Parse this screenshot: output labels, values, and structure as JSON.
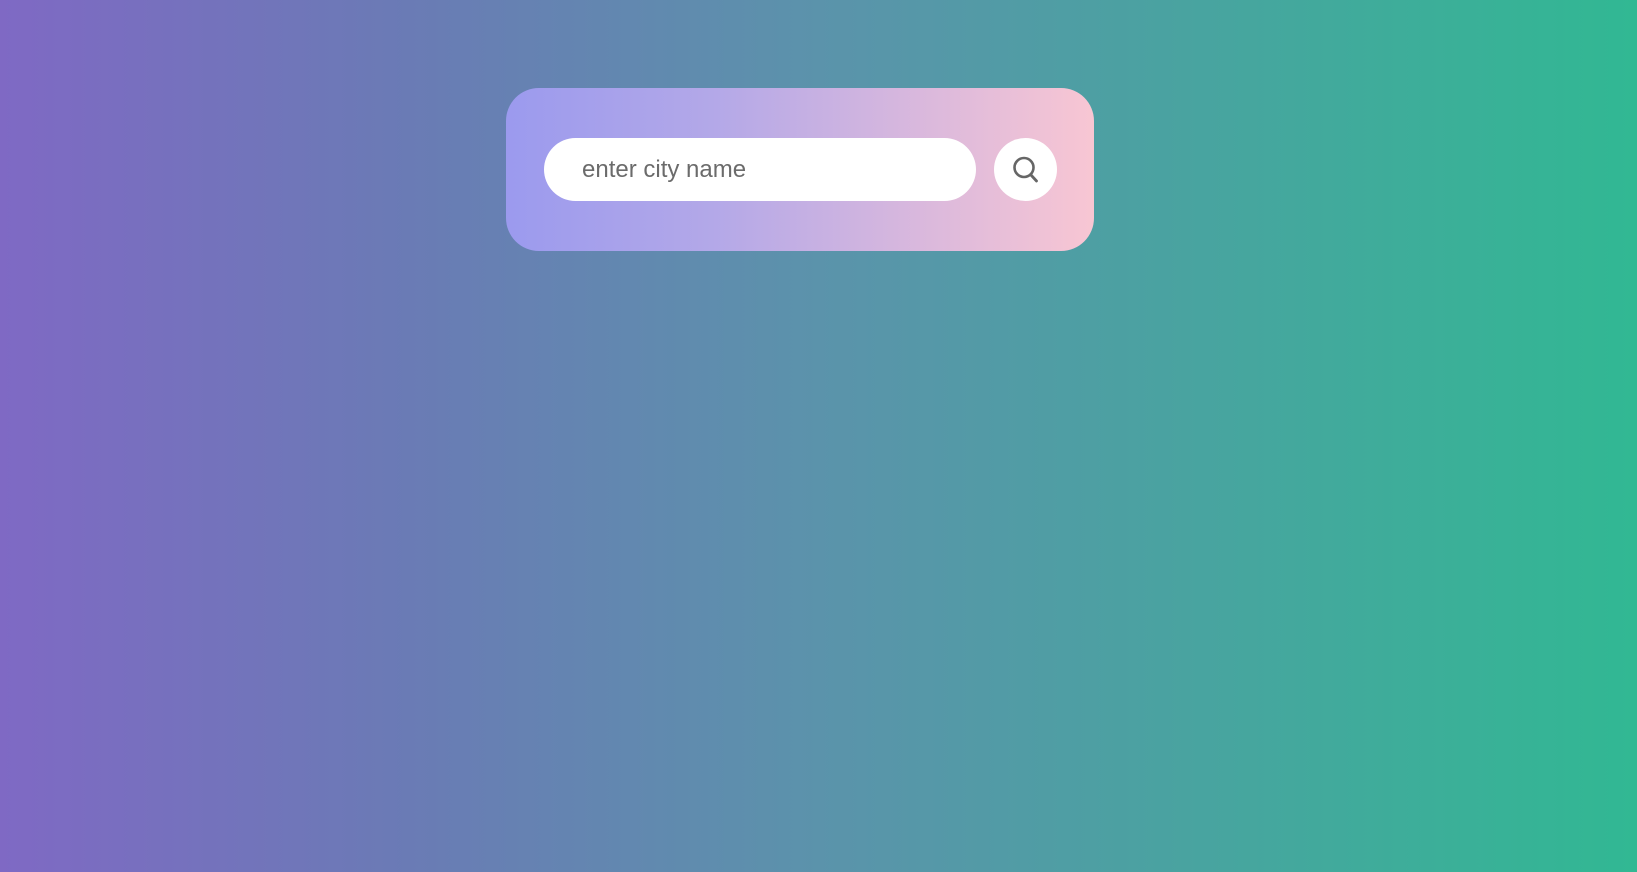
{
  "search": {
    "placeholder": "enter city name",
    "value": "",
    "button_icon": "search-icon"
  },
  "colors": {
    "background_start": "#7f69c4",
    "background_end": "#31b893",
    "card_start": "#9b9aee",
    "card_end": "#f8c6d3",
    "input_background": "#ffffff",
    "icon_color": "#666666"
  }
}
